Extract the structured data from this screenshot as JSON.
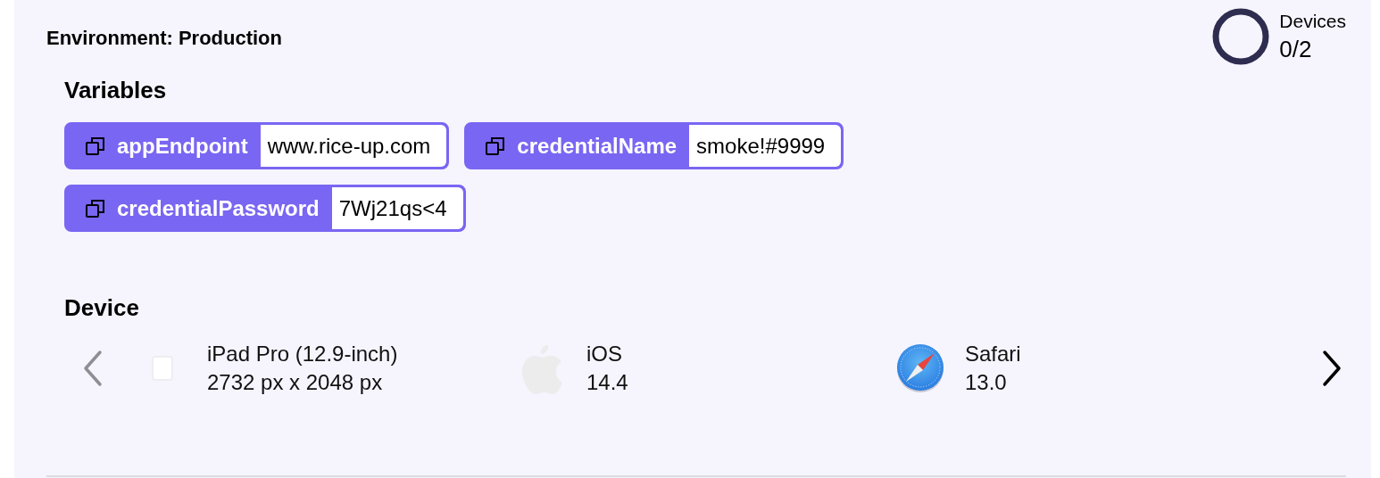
{
  "environment": {
    "title": "Environment: Production"
  },
  "devices_meter": {
    "label": "Devices",
    "count": "0/2",
    "level": 0
  },
  "variables": {
    "heading": "Variables",
    "items": [
      {
        "name": "appEndpoint",
        "value": "www.rice-up.com"
      },
      {
        "name": "credentialName",
        "value": "smoke!#9999"
      },
      {
        "name": "credentialPassword",
        "value": "7Wj21qs<4"
      }
    ]
  },
  "device": {
    "heading": "Device",
    "prev": {
      "disabled": true
    },
    "next": {
      "disabled": false
    },
    "items": [
      {
        "kind": "tablet",
        "name": "iPad Pro (12.9-inch)",
        "detail": "2732 px x 2048 px"
      },
      {
        "kind": "os",
        "name": "iOS",
        "detail": "14.4"
      },
      {
        "kind": "browser",
        "name": "Safari",
        "detail": "13.0"
      }
    ]
  }
}
